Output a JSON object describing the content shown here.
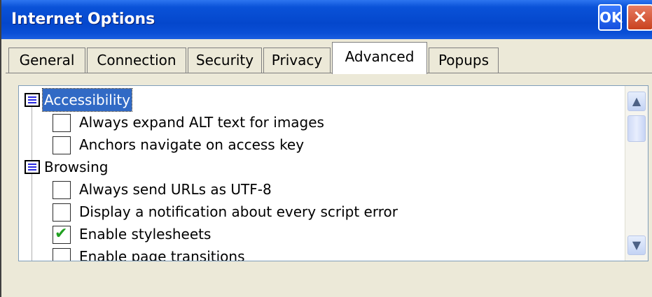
{
  "window": {
    "title": "Internet Options",
    "ok_label": "OK",
    "close_label": "×"
  },
  "tabs": [
    {
      "label": "General"
    },
    {
      "label": "Connection"
    },
    {
      "label": "Security"
    },
    {
      "label": "Privacy"
    },
    {
      "label": "Advanced",
      "active": true
    },
    {
      "label": "Popups"
    }
  ],
  "settings": {
    "categories": [
      {
        "label": "Accessibility",
        "icon": "category-list-icon",
        "selected": true,
        "items": [
          {
            "label": "Always expand ALT text for images",
            "checked": false
          },
          {
            "label": "Anchors navigate on access key",
            "checked": false
          }
        ]
      },
      {
        "label": "Browsing",
        "icon": "category-list-icon",
        "selected": false,
        "items": [
          {
            "label": "Always send URLs as UTF-8",
            "checked": false
          },
          {
            "label": "Display a notification about every script error",
            "checked": false
          },
          {
            "label": "Enable stylesheets",
            "checked": true
          },
          {
            "label": "Enable page transitions",
            "checked": false
          }
        ]
      }
    ]
  },
  "colors": {
    "title_bar": "#0447cc",
    "selection": "#316ac5",
    "checkmark": "#20a020"
  }
}
